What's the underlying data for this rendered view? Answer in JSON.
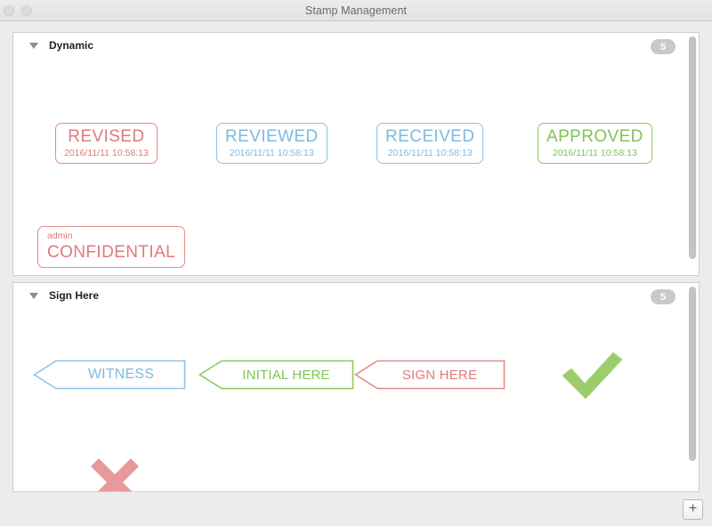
{
  "window": {
    "title": "Stamp Management",
    "traffic_lights": [
      "close-button",
      "minimize-button",
      "zoom-button"
    ]
  },
  "colors": {
    "red": "#e08b8b",
    "red_text": "#e07a7a",
    "blue": "#8cc3e8",
    "blue_text": "#7fb9e0",
    "green": "#8dc85a",
    "green_text": "#83c254",
    "check_green": "#9ccc6b",
    "cross_red": "#e89a9a",
    "badge_gray": "#c9c9c9",
    "panel_border": "#cfcfcf",
    "titlebar": "#ececec"
  },
  "sections": [
    {
      "title": "Dynamic",
      "count": "5",
      "expanded": true,
      "stamps": [
        {
          "name": "revised-stamp",
          "label": "REVISED",
          "date": "2016/11/11 10:58:13",
          "color": "red"
        },
        {
          "name": "reviewed-stamp",
          "label": "REVIEWED",
          "date": "2016/11/11 10:58:13",
          "color": "blue"
        },
        {
          "name": "received-stamp",
          "label": "RECEIVED",
          "date": "2016/11/11 10:58:13",
          "color": "blue"
        },
        {
          "name": "approved-stamp",
          "label": "APPROVED",
          "date": "2016/11/11 10:58:13",
          "color": "green"
        },
        {
          "name": "confidential-stamp",
          "label": "CONFIDENTIAL",
          "sub": "admin",
          "color": "red"
        }
      ]
    },
    {
      "title": "Sign Here",
      "count": "5",
      "expanded": true,
      "stamps": [
        {
          "name": "witness-stamp",
          "label": "WITNESS",
          "color": "blue",
          "shape": "arrow-left"
        },
        {
          "name": "initial-here-stamp",
          "label": "INITIAL HERE",
          "color": "green",
          "shape": "arrow-left"
        },
        {
          "name": "sign-here-stamp",
          "label": "SIGN HERE",
          "color": "red",
          "shape": "arrow-left"
        },
        {
          "name": "check-mark-stamp",
          "label": "",
          "color": "check_green",
          "shape": "check"
        },
        {
          "name": "cross-mark-stamp",
          "label": "",
          "color": "cross_red",
          "shape": "cross"
        }
      ]
    }
  ],
  "toolbar": {
    "add_label": "+"
  }
}
